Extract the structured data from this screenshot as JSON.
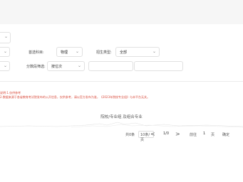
{
  "filters": {
    "subject_label": "首选科目:",
    "subject_value": "物理",
    "admission_label": "招生类型:",
    "admission_value": "全部",
    "batch_label": "分数段筛选:",
    "batch_value": "按位次"
  },
  "notes": [
    "说明:1.仅供参考",
    "2.数据来源于各省教育考试院发布的公开信息，仅供参考，请以官方发布为准，《2023年院校专业组》与本平台无关。"
  ],
  "table": {
    "empty_title": "院校/专业组 及组合专业"
  },
  "pagination": {
    "total": "共0条",
    "page_size": "10条/页",
    "prev": "<",
    "page_info": "1/0",
    "next": ">",
    "goto_label": "前往",
    "goto_value": "1",
    "page_unit": "页",
    "confirm": "确定"
  }
}
